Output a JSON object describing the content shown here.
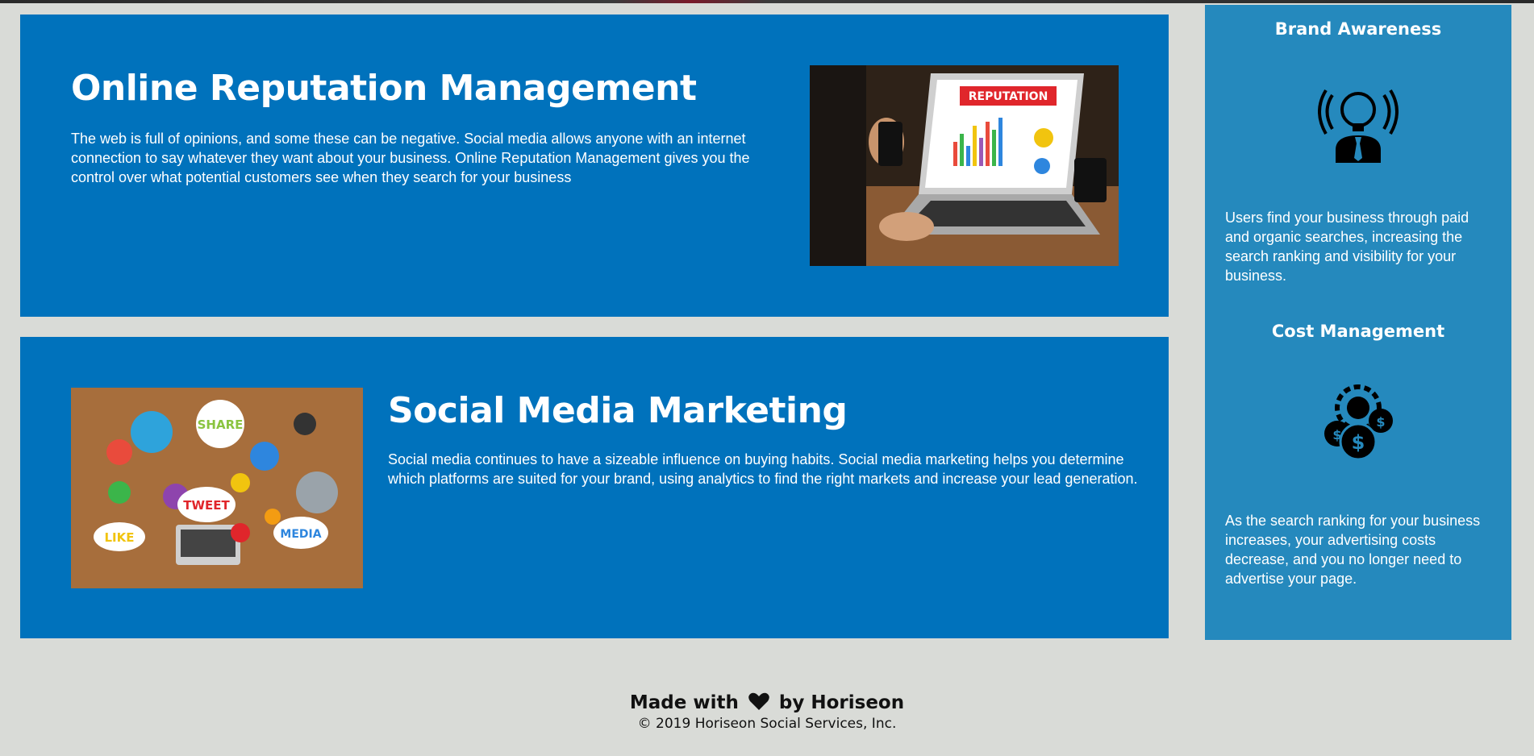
{
  "sections": {
    "reputation": {
      "title": "Online Reputation Management",
      "body": "The web is full of opinions, and some these can be negative. Social media allows anyone with an internet connection to say whatever they want about your business. Online Reputation Management gives you the control over what potential customers see when they search for your business",
      "image_banner": "REPUTATION"
    },
    "social": {
      "title": "Social Media Marketing",
      "body": "Social media continues to have a sizeable influence on buying habits. Social media marketing helps you determine which platforms are suited for your brand, using analytics to find the right markets and increase your lead generation.",
      "bubbles": [
        "SHARE",
        "TWEET",
        "LIKE",
        "MEDIA"
      ]
    }
  },
  "aside": {
    "brand": {
      "title": "Brand Awareness",
      "icon": "lightbulb-person-icon",
      "body": "Users find your business through paid and organic searches, increasing the search ranking and visibility for your business."
    },
    "cost": {
      "title": "Cost Management",
      "icon": "gear-coins-icon",
      "body": "As the search ranking for your business increases, your advertising costs decrease, and you no longer need to advertise your page."
    }
  },
  "footer": {
    "made_prefix": "Made with",
    "made_suffix": "by Horiseon",
    "copyright": "© 2019 Horiseon Social Services, Inc."
  },
  "colors": {
    "card": "#0072bc",
    "aside": "#2589bd",
    "page": "#d9dbd7"
  }
}
